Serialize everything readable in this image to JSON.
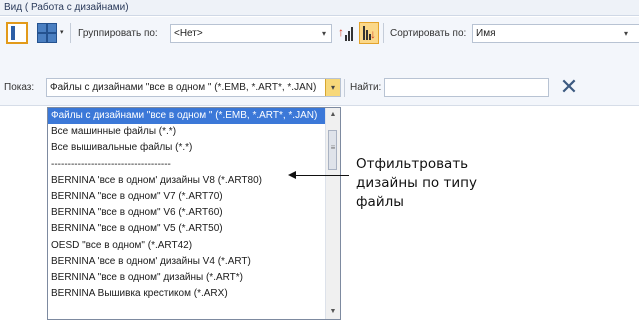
{
  "window": {
    "title": "Вид ( Работа с дизайнами)"
  },
  "toolbar": {
    "group_label": "Группировать по:",
    "group_value": "<Нет>",
    "sort_label": "Сортировать по:",
    "sort_value": "Имя"
  },
  "filter": {
    "show_label": "Показ:",
    "show_value": "Файлы с дизайнами \"все в одном \" (*.EMB, *.ART*, *.JAN)",
    "find_label": "Найти:",
    "find_value": ""
  },
  "dropdown": {
    "items": [
      "Файлы с дизайнами \"все в одном \" (*.EMB, *.ART*, *.JAN)",
      "Все машинные файлы (*.*)",
      "Все вышивальные файлы (*.*)",
      "------------------------------------",
      "BERNINA 'все в одном' дизайны V8 (*.ART80)",
      "BERNINA \"все в одном\" V7 (*.ART70)",
      "BERNINA \"все в одном\" V6 (*.ART60)",
      "BERNINA \"все в одном\" V5 (*.ART50)",
      "OESD \"все в одном\" (*.ART42)",
      "BERNINA 'все в одном' дизайны V4 (*.ART)",
      "BERNINA \"все в одном\" дизайны (*.ART*)",
      "BERNINA Вышивка крестиком (*.ARX)"
    ],
    "selected_index": 0
  },
  "annotation": {
    "line1": "Отфильтровать",
    "line2": "дизайны по типу",
    "line3": "файлы"
  },
  "colors": {
    "selection": "#3b78d8",
    "highlight": "#fbd889"
  }
}
